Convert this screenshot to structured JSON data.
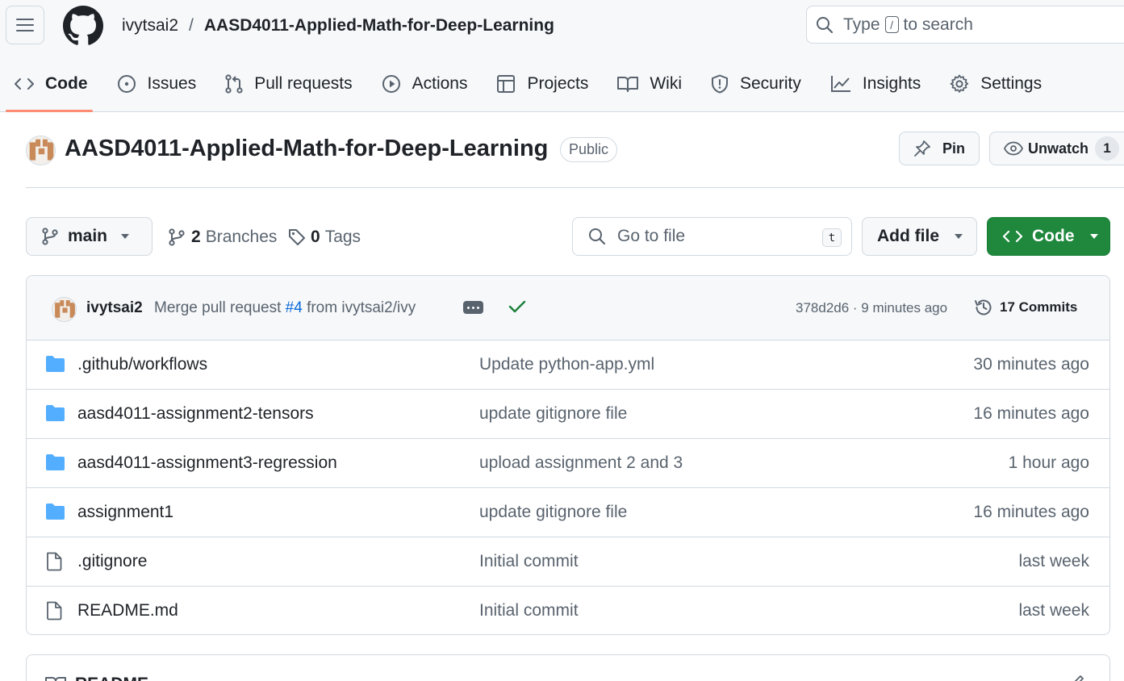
{
  "header": {
    "owner": "ivytsai2",
    "separator": "/",
    "repo": "AASD4011-Applied-Math-for-Deep-Learning",
    "search": {
      "prefix": "Type",
      "key": "/",
      "suffix": "to search"
    }
  },
  "tabs": [
    {
      "label": "Code",
      "icon": "code-icon"
    },
    {
      "label": "Issues",
      "icon": "issue-icon"
    },
    {
      "label": "Pull requests",
      "icon": "pull-request-icon"
    },
    {
      "label": "Actions",
      "icon": "play-icon"
    },
    {
      "label": "Projects",
      "icon": "table-icon"
    },
    {
      "label": "Wiki",
      "icon": "book-icon"
    },
    {
      "label": "Security",
      "icon": "shield-icon"
    },
    {
      "label": "Insights",
      "icon": "graph-icon"
    },
    {
      "label": "Settings",
      "icon": "gear-icon"
    }
  ],
  "repo": {
    "title": "AASD4011-Applied-Math-for-Deep-Learning",
    "visibility": "Public",
    "pin_label": "Pin",
    "unwatch_label": "Unwatch",
    "watch_count": "1"
  },
  "filenav": {
    "branch": "main",
    "branches_count": "2",
    "branches_label": "Branches",
    "tags_count": "0",
    "tags_label": "Tags",
    "goto_placeholder": "Go to file",
    "goto_key": "t",
    "add_file_label": "Add file",
    "code_label": "Code"
  },
  "commit": {
    "author": "ivytsai2",
    "message_prefix": "Merge pull request",
    "pr": "#4",
    "message_suffix": "from ivytsai2/ivy",
    "meta": "378d2d6 · 9 minutes ago",
    "commits_label": "17 Commits"
  },
  "files": [
    {
      "name": ".github/workflows",
      "type": "folder",
      "message": "Update python-app.yml",
      "time": "30 minutes ago"
    },
    {
      "name": "aasd4011-assignment2-tensors",
      "type": "folder",
      "message": "update gitignore file",
      "time": "16 minutes ago"
    },
    {
      "name": "aasd4011-assignment3-regression",
      "type": "folder",
      "message": "upload assignment 2 and 3",
      "time": "1 hour ago"
    },
    {
      "name": "assignment1",
      "type": "folder",
      "message": "update gitignore file",
      "time": "16 minutes ago"
    },
    {
      "name": ".gitignore",
      "type": "file",
      "message": "Initial commit",
      "time": "last week"
    },
    {
      "name": "README.md",
      "type": "file",
      "message": "Initial commit",
      "time": "last week"
    }
  ],
  "readme": {
    "label": "README"
  },
  "colors": {
    "accent_underline": "#fd8c73",
    "code_button": "#1f883d",
    "folder": "#54aeff",
    "link": "#0969da",
    "success": "#1a7f37"
  }
}
